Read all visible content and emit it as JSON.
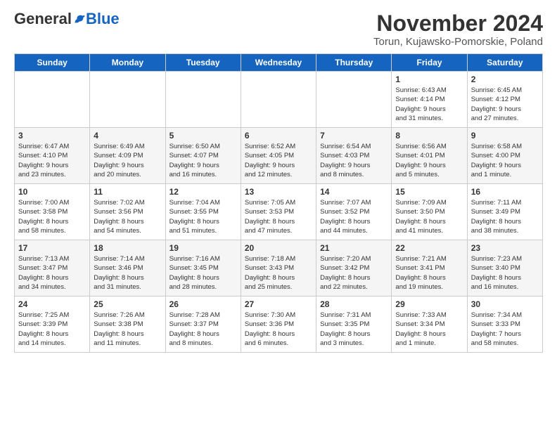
{
  "logo": {
    "general": "General",
    "blue": "Blue"
  },
  "header": {
    "month_title": "November 2024",
    "subtitle": "Torun, Kujawsko-Pomorskie, Poland"
  },
  "days_of_week": [
    "Sunday",
    "Monday",
    "Tuesday",
    "Wednesday",
    "Thursday",
    "Friday",
    "Saturday"
  ],
  "weeks": [
    [
      {
        "day": "",
        "info": ""
      },
      {
        "day": "",
        "info": ""
      },
      {
        "day": "",
        "info": ""
      },
      {
        "day": "",
        "info": ""
      },
      {
        "day": "",
        "info": ""
      },
      {
        "day": "1",
        "info": "Sunrise: 6:43 AM\nSunset: 4:14 PM\nDaylight: 9 hours\nand 31 minutes."
      },
      {
        "day": "2",
        "info": "Sunrise: 6:45 AM\nSunset: 4:12 PM\nDaylight: 9 hours\nand 27 minutes."
      }
    ],
    [
      {
        "day": "3",
        "info": "Sunrise: 6:47 AM\nSunset: 4:10 PM\nDaylight: 9 hours\nand 23 minutes."
      },
      {
        "day": "4",
        "info": "Sunrise: 6:49 AM\nSunset: 4:09 PM\nDaylight: 9 hours\nand 20 minutes."
      },
      {
        "day": "5",
        "info": "Sunrise: 6:50 AM\nSunset: 4:07 PM\nDaylight: 9 hours\nand 16 minutes."
      },
      {
        "day": "6",
        "info": "Sunrise: 6:52 AM\nSunset: 4:05 PM\nDaylight: 9 hours\nand 12 minutes."
      },
      {
        "day": "7",
        "info": "Sunrise: 6:54 AM\nSunset: 4:03 PM\nDaylight: 9 hours\nand 8 minutes."
      },
      {
        "day": "8",
        "info": "Sunrise: 6:56 AM\nSunset: 4:01 PM\nDaylight: 9 hours\nand 5 minutes."
      },
      {
        "day": "9",
        "info": "Sunrise: 6:58 AM\nSunset: 4:00 PM\nDaylight: 9 hours\nand 1 minute."
      }
    ],
    [
      {
        "day": "10",
        "info": "Sunrise: 7:00 AM\nSunset: 3:58 PM\nDaylight: 8 hours\nand 58 minutes."
      },
      {
        "day": "11",
        "info": "Sunrise: 7:02 AM\nSunset: 3:56 PM\nDaylight: 8 hours\nand 54 minutes."
      },
      {
        "day": "12",
        "info": "Sunrise: 7:04 AM\nSunset: 3:55 PM\nDaylight: 8 hours\nand 51 minutes."
      },
      {
        "day": "13",
        "info": "Sunrise: 7:05 AM\nSunset: 3:53 PM\nDaylight: 8 hours\nand 47 minutes."
      },
      {
        "day": "14",
        "info": "Sunrise: 7:07 AM\nSunset: 3:52 PM\nDaylight: 8 hours\nand 44 minutes."
      },
      {
        "day": "15",
        "info": "Sunrise: 7:09 AM\nSunset: 3:50 PM\nDaylight: 8 hours\nand 41 minutes."
      },
      {
        "day": "16",
        "info": "Sunrise: 7:11 AM\nSunset: 3:49 PM\nDaylight: 8 hours\nand 38 minutes."
      }
    ],
    [
      {
        "day": "17",
        "info": "Sunrise: 7:13 AM\nSunset: 3:47 PM\nDaylight: 8 hours\nand 34 minutes."
      },
      {
        "day": "18",
        "info": "Sunrise: 7:14 AM\nSunset: 3:46 PM\nDaylight: 8 hours\nand 31 minutes."
      },
      {
        "day": "19",
        "info": "Sunrise: 7:16 AM\nSunset: 3:45 PM\nDaylight: 8 hours\nand 28 minutes."
      },
      {
        "day": "20",
        "info": "Sunrise: 7:18 AM\nSunset: 3:43 PM\nDaylight: 8 hours\nand 25 minutes."
      },
      {
        "day": "21",
        "info": "Sunrise: 7:20 AM\nSunset: 3:42 PM\nDaylight: 8 hours\nand 22 minutes."
      },
      {
        "day": "22",
        "info": "Sunrise: 7:21 AM\nSunset: 3:41 PM\nDaylight: 8 hours\nand 19 minutes."
      },
      {
        "day": "23",
        "info": "Sunrise: 7:23 AM\nSunset: 3:40 PM\nDaylight: 8 hours\nand 16 minutes."
      }
    ],
    [
      {
        "day": "24",
        "info": "Sunrise: 7:25 AM\nSunset: 3:39 PM\nDaylight: 8 hours\nand 14 minutes."
      },
      {
        "day": "25",
        "info": "Sunrise: 7:26 AM\nSunset: 3:38 PM\nDaylight: 8 hours\nand 11 minutes."
      },
      {
        "day": "26",
        "info": "Sunrise: 7:28 AM\nSunset: 3:37 PM\nDaylight: 8 hours\nand 8 minutes."
      },
      {
        "day": "27",
        "info": "Sunrise: 7:30 AM\nSunset: 3:36 PM\nDaylight: 8 hours\nand 6 minutes."
      },
      {
        "day": "28",
        "info": "Sunrise: 7:31 AM\nSunset: 3:35 PM\nDaylight: 8 hours\nand 3 minutes."
      },
      {
        "day": "29",
        "info": "Sunrise: 7:33 AM\nSunset: 3:34 PM\nDaylight: 8 hours\nand 1 minute."
      },
      {
        "day": "30",
        "info": "Sunrise: 7:34 AM\nSunset: 3:33 PM\nDaylight: 7 hours\nand 58 minutes."
      }
    ]
  ]
}
